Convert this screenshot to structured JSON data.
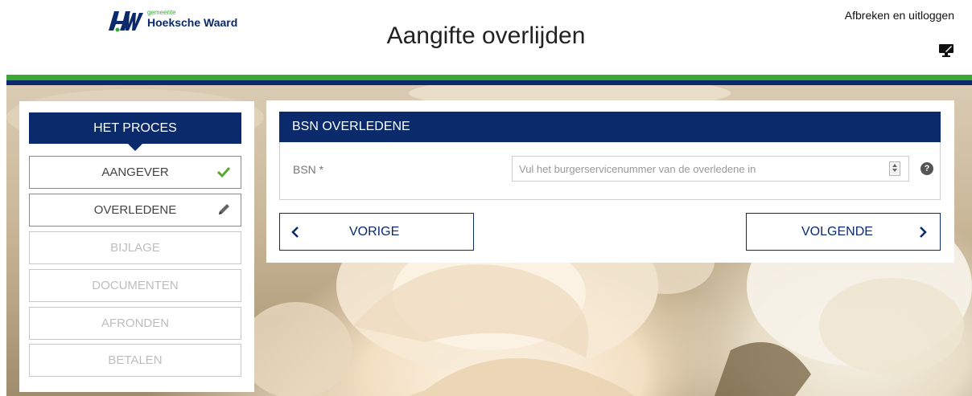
{
  "header": {
    "logo_small": "gemeente",
    "logo_name": "Hoeksche Waard",
    "title": "Aangifte overlijden",
    "logout": "Afbreken en uitloggen"
  },
  "sidebar": {
    "title": "HET PROCES",
    "steps": [
      {
        "label": "AANGEVER",
        "state": "done",
        "icon": "check-icon"
      },
      {
        "label": "OVERLEDENE",
        "state": "current",
        "icon": "pencil-icon"
      },
      {
        "label": "BIJLAGE",
        "state": "disabled"
      },
      {
        "label": "DOCUMENTEN",
        "state": "disabled"
      },
      {
        "label": "AFRONDEN",
        "state": "disabled"
      },
      {
        "label": "BETALEN",
        "state": "disabled"
      }
    ]
  },
  "panel": {
    "title": "BSN OVERLEDENE",
    "bsn_label": "BSN *",
    "bsn_value": "",
    "bsn_placeholder": "Vul het burgerservicenummer van de overledene in",
    "help": "?"
  },
  "nav": {
    "prev": "VORIGE",
    "next": "VOLGENDE"
  },
  "colors": {
    "navy": "#0b2a6b",
    "green": "#3aa935",
    "check": "#5aa832"
  }
}
